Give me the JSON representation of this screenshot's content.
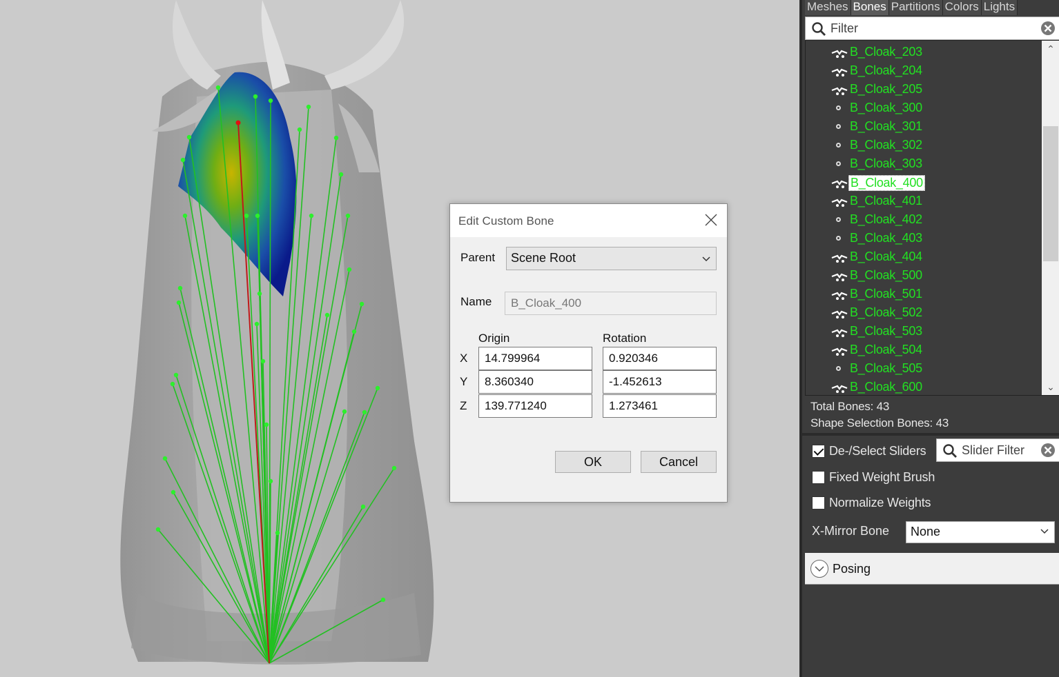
{
  "tabs": [
    "Meshes",
    "Bones",
    "Partitions",
    "Colors",
    "Lights"
  ],
  "active_tab": "Bones",
  "filter": {
    "placeholder": "Filter"
  },
  "bones": [
    {
      "name": "B_Cloak_203",
      "icon": "bone-branch-icon"
    },
    {
      "name": "B_Cloak_204",
      "icon": "bone-branch-icon"
    },
    {
      "name": "B_Cloak_205",
      "icon": "bone-branch-icon"
    },
    {
      "name": "B_Cloak_300",
      "icon": "bone-leaf-icon"
    },
    {
      "name": "B_Cloak_301",
      "icon": "bone-leaf-icon"
    },
    {
      "name": "B_Cloak_302",
      "icon": "bone-leaf-icon"
    },
    {
      "name": "B_Cloak_303",
      "icon": "bone-leaf-icon"
    },
    {
      "name": "B_Cloak_400",
      "icon": "bone-branch-icon",
      "selected": true
    },
    {
      "name": "B_Cloak_401",
      "icon": "bone-branch-icon"
    },
    {
      "name": "B_Cloak_402",
      "icon": "bone-leaf-icon"
    },
    {
      "name": "B_Cloak_403",
      "icon": "bone-leaf-icon"
    },
    {
      "name": "B_Cloak_404",
      "icon": "bone-branch-icon"
    },
    {
      "name": "B_Cloak_500",
      "icon": "bone-branch-icon"
    },
    {
      "name": "B_Cloak_501",
      "icon": "bone-branch-icon"
    },
    {
      "name": "B_Cloak_502",
      "icon": "bone-branch-icon"
    },
    {
      "name": "B_Cloak_503",
      "icon": "bone-branch-icon"
    },
    {
      "name": "B_Cloak_504",
      "icon": "bone-branch-icon"
    },
    {
      "name": "B_Cloak_505",
      "icon": "bone-leaf-icon"
    },
    {
      "name": "B_Cloak_600",
      "icon": "bone-branch-icon"
    }
  ],
  "stats": {
    "total": "Total Bones: 43",
    "shape_selection": "Shape Selection Bones: 43"
  },
  "options": {
    "deselect_sliders": {
      "label": "De-/Select Sliders",
      "checked": true
    },
    "slider_filter_placeholder": "Slider Filter",
    "fixed_weight_brush": {
      "label": "Fixed Weight Brush",
      "checked": false
    },
    "normalize_weights": {
      "label": "Normalize Weights",
      "checked": false
    },
    "xmirror_label": "X-Mirror Bone",
    "xmirror_value": "None",
    "posing_label": "Posing"
  },
  "dialog": {
    "title": "Edit Custom Bone",
    "parent_label": "Parent",
    "parent_value": "Scene Root",
    "name_label": "Name",
    "name_value": "B_Cloak_400",
    "origin_label": "Origin",
    "rotation_label": "Rotation",
    "axes": [
      "X",
      "Y",
      "Z"
    ],
    "origin": [
      "14.799964",
      "8.360340",
      "139.771240"
    ],
    "rotation": [
      "0.920346",
      "-1.452613",
      "1.273461"
    ],
    "ok_label": "OK",
    "cancel_label": "Cancel"
  },
  "colors": {
    "bone_text": "#22e022",
    "bone_line": "#22c022",
    "selected_bone_line": "#c01a1a",
    "panel_bg": "#3c3c3c",
    "viewport_bg": "#cbcbcb"
  }
}
